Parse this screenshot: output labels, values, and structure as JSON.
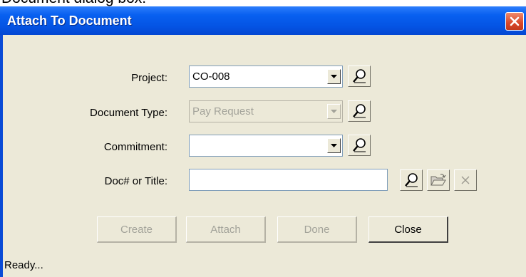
{
  "caption": "Document dialog box.",
  "window": {
    "title": "Attach To Document"
  },
  "fields": {
    "project": {
      "label": "Project:",
      "value": "CO-008"
    },
    "document_type": {
      "label": "Document Type:",
      "value": "Pay Request",
      "enabled": false
    },
    "commitment": {
      "label": "Commitment:",
      "value": ""
    },
    "doc_title": {
      "label": "Doc# or Title:",
      "value": ""
    }
  },
  "buttons": {
    "create": {
      "label": "Create",
      "enabled": false
    },
    "attach": {
      "label": "Attach",
      "enabled": false
    },
    "done": {
      "label": "Done",
      "enabled": false
    },
    "close": {
      "label": "Close",
      "enabled": true
    }
  },
  "status": "Ready...",
  "icons": [
    "search-icon",
    "open-folder-icon",
    "clear-icon",
    "chevron-down-icon",
    "close-icon"
  ],
  "colors": {
    "titlebar": "#0454e4",
    "client": "#ece9d8",
    "close_button": "#d8472a",
    "disabled_text": "#a3a39a"
  }
}
